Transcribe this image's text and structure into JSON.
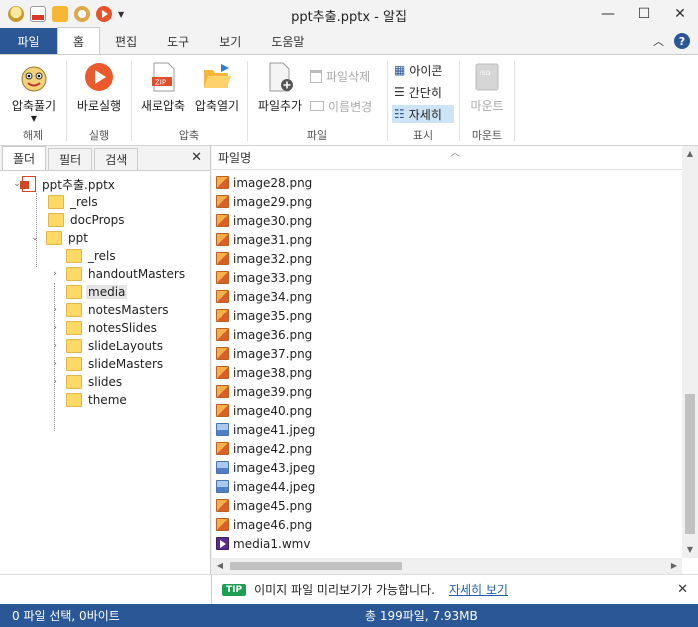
{
  "window": {
    "title": "ppt추출.pptx - 알집",
    "quick_access_icons": [
      "app-logo-icon",
      "zip-icon",
      "open-folder-icon",
      "extract-icon",
      "run-icon"
    ]
  },
  "tabs": {
    "file": "파일",
    "items": [
      "홈",
      "편집",
      "도구",
      "보기",
      "도움말"
    ],
    "active": "홈"
  },
  "ribbon": {
    "groups": {
      "unpack": "해제",
      "run": "실행",
      "compress": "압축",
      "file": "파일",
      "view": "표시",
      "mount": "마운트"
    },
    "buttons": {
      "extract": "압축풀기",
      "run_now": "바로실행",
      "new_zip": "새로압축",
      "open_zip": "압축열기",
      "add_file": "파일추가",
      "delete_file": "파일삭제",
      "rename": "이름변경",
      "icons": "아이콘",
      "simple": "간단히",
      "detail": "자세히",
      "mount": "마운트"
    }
  },
  "left_pane": {
    "tabs": [
      "폴더",
      "필터",
      "검색"
    ],
    "active_tab": "폴더",
    "tree": {
      "root": "ppt추출.pptx",
      "level1": [
        "_rels",
        "docProps",
        "ppt"
      ],
      "ppt_children": [
        "_rels",
        "handoutMasters",
        "media",
        "notesMasters",
        "notesSlides",
        "slideLayouts",
        "slideMasters",
        "slides",
        "theme"
      ],
      "selected": "media"
    }
  },
  "file_list": {
    "column_header": "파일명",
    "files": [
      {
        "name": "image28.png",
        "type": "png"
      },
      {
        "name": "image29.png",
        "type": "png"
      },
      {
        "name": "image30.png",
        "type": "png"
      },
      {
        "name": "image31.png",
        "type": "png"
      },
      {
        "name": "image32.png",
        "type": "png"
      },
      {
        "name": "image33.png",
        "type": "png"
      },
      {
        "name": "image34.png",
        "type": "png"
      },
      {
        "name": "image35.png",
        "type": "png"
      },
      {
        "name": "image36.png",
        "type": "png"
      },
      {
        "name": "image37.png",
        "type": "png"
      },
      {
        "name": "image38.png",
        "type": "png"
      },
      {
        "name": "image39.png",
        "type": "png"
      },
      {
        "name": "image40.png",
        "type": "png"
      },
      {
        "name": "image41.jpeg",
        "type": "jpeg"
      },
      {
        "name": "image42.png",
        "type": "png"
      },
      {
        "name": "image43.jpeg",
        "type": "jpeg"
      },
      {
        "name": "image44.jpeg",
        "type": "jpeg"
      },
      {
        "name": "image45.png",
        "type": "png"
      },
      {
        "name": "image46.png",
        "type": "png"
      },
      {
        "name": "media1.wmv",
        "type": "wmv"
      }
    ]
  },
  "info_bar": {
    "badge": "TIP",
    "text": "이미지 파일 미리보기가 가능합니다.",
    "link": "자세히 보기"
  },
  "status_bar": {
    "selection": "0 파일 선택,  0바이트",
    "total": "총 199파일,  7.93MB"
  },
  "colors": {
    "accent": "#2b5797",
    "selected_view": "#cde4f7",
    "tip_green": "#1e9e55",
    "link": "#1f5fb5"
  }
}
